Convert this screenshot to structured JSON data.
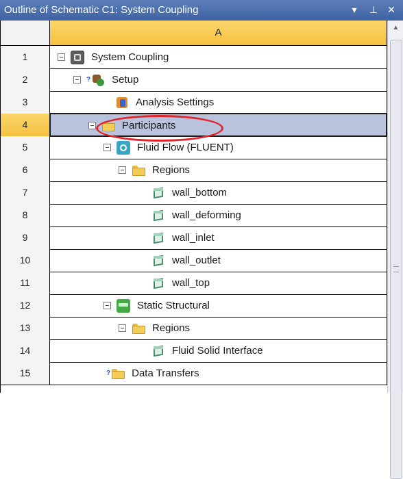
{
  "window": {
    "title": "Outline of Schematic C1: System Coupling",
    "controls": [
      "▾",
      "⊥",
      "✕"
    ]
  },
  "grid": {
    "column_header": "A",
    "rows": [
      {
        "num": "1",
        "label": "System Coupling",
        "icon": "system-coupling-icon"
      },
      {
        "num": "2",
        "label": "Setup",
        "icon": "setup-icon"
      },
      {
        "num": "3",
        "label": "Analysis Settings",
        "icon": "analysis-settings-icon"
      },
      {
        "num": "4",
        "label": "Participants",
        "icon": "folder-icon",
        "selected": true
      },
      {
        "num": "5",
        "label": "Fluid Flow (FLUENT)",
        "icon": "fluent-icon"
      },
      {
        "num": "6",
        "label": "Regions",
        "icon": "folder-icon"
      },
      {
        "num": "7",
        "label": "wall_bottom",
        "icon": "region-icon"
      },
      {
        "num": "8",
        "label": "wall_deforming",
        "icon": "region-icon"
      },
      {
        "num": "9",
        "label": "wall_inlet",
        "icon": "region-icon"
      },
      {
        "num": "10",
        "label": "wall_outlet",
        "icon": "region-icon"
      },
      {
        "num": "11",
        "label": "wall_top",
        "icon": "region-icon"
      },
      {
        "num": "12",
        "label": "Static Structural",
        "icon": "static-structural-icon"
      },
      {
        "num": "13",
        "label": "Regions",
        "icon": "folder-icon"
      },
      {
        "num": "14",
        "label": "Fluid Solid Interface",
        "icon": "region-icon"
      },
      {
        "num": "15",
        "label": "Data Transfers",
        "icon": "folder-icon"
      }
    ]
  },
  "colors": {
    "title_bar": "#4a6cab",
    "header_fill": "#f6c03f",
    "selection_fill": "#b9c3dd",
    "annotation_oval": "#e0262b"
  }
}
